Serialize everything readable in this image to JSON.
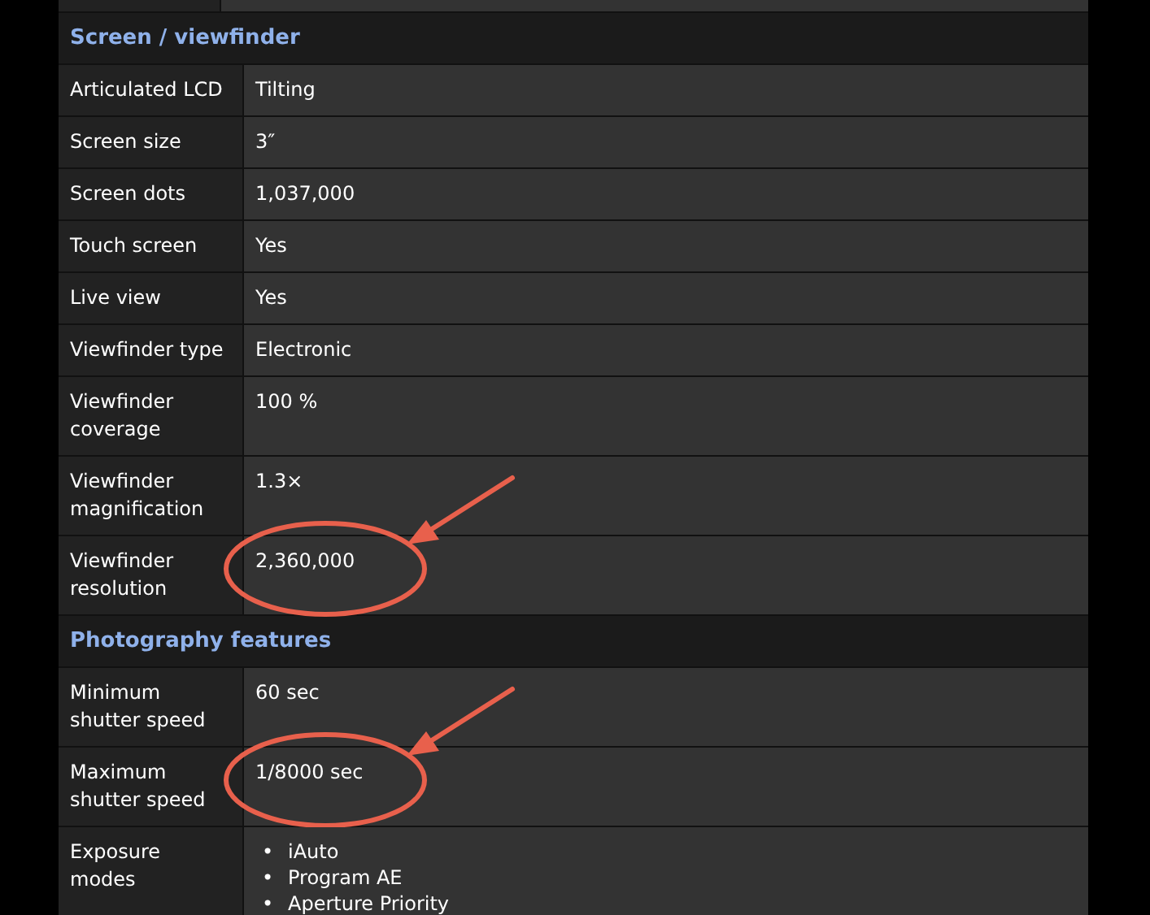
{
  "sections": [
    {
      "title": "Screen / viewfinder",
      "rows": [
        {
          "label": "Articulated LCD",
          "value": "Tilting",
          "annotated": false
        },
        {
          "label": "Screen size",
          "value": "3″",
          "annotated": false
        },
        {
          "label": "Screen dots",
          "value": "1,037,000",
          "annotated": false
        },
        {
          "label": "Touch screen",
          "value": "Yes",
          "annotated": false
        },
        {
          "label": "Live view",
          "value": "Yes",
          "annotated": false
        },
        {
          "label": "Viewfinder type",
          "value": "Electronic",
          "annotated": false
        },
        {
          "label": "Viewfinder coverage",
          "value": "100 %",
          "annotated": false
        },
        {
          "label": "Viewfinder magnification",
          "value": "1.3×",
          "annotated": false
        },
        {
          "label": "Viewfinder resolution",
          "value": "2,360,000",
          "annotated": true
        }
      ]
    },
    {
      "title": "Photography features",
      "rows": [
        {
          "label": "Minimum shutter speed",
          "value": "60 sec",
          "annotated": false
        },
        {
          "label": "Maximum shutter speed",
          "value": "1/8000 sec",
          "annotated": true
        },
        {
          "label": "Exposure modes",
          "items": [
            {
              "marker": "•",
              "text": "iAuto"
            },
            {
              "marker": "•",
              "text": "Program AE"
            },
            {
              "marker": "•",
              "text": "Aperture Priority"
            }
          ],
          "annotated": false
        }
      ]
    }
  ]
}
